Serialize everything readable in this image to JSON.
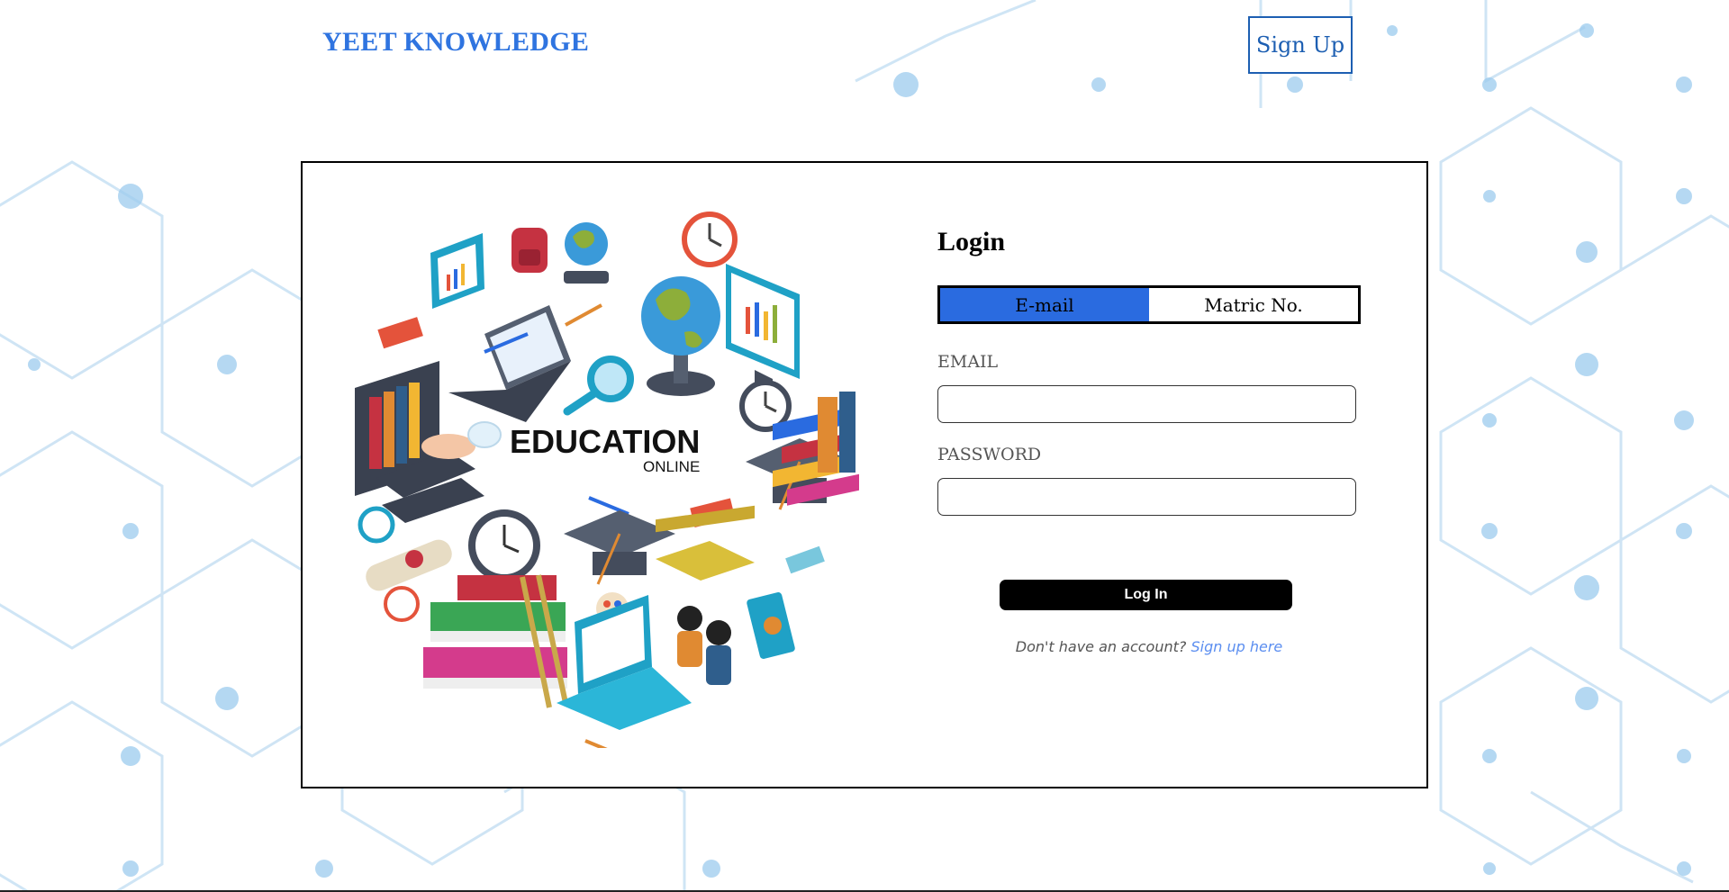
{
  "header": {
    "brand": "YEET KNOWLEDGE",
    "signup_label": "Sign Up"
  },
  "illustration": {
    "title": "EDUCATION",
    "subtitle": "ONLINE"
  },
  "login": {
    "title": "Login",
    "tabs": [
      {
        "label": "E-mail",
        "active": true
      },
      {
        "label": "Matric No.",
        "active": false
      }
    ],
    "email_label": "EMAIL",
    "email_value": "",
    "password_label": "PASSWORD",
    "password_value": "",
    "submit_label": "Log In",
    "footer_text": "Don't have an account?",
    "footer_link": "Sign up here"
  },
  "colors": {
    "brand": "#2f74e0",
    "tab_active": "#2a6be0",
    "signup_border": "#1d5fb2",
    "link": "#5b8ef0",
    "background_pattern": "#bcdcf2"
  },
  "icons": [
    "hexagon-network-pattern",
    "education-illustration"
  ]
}
